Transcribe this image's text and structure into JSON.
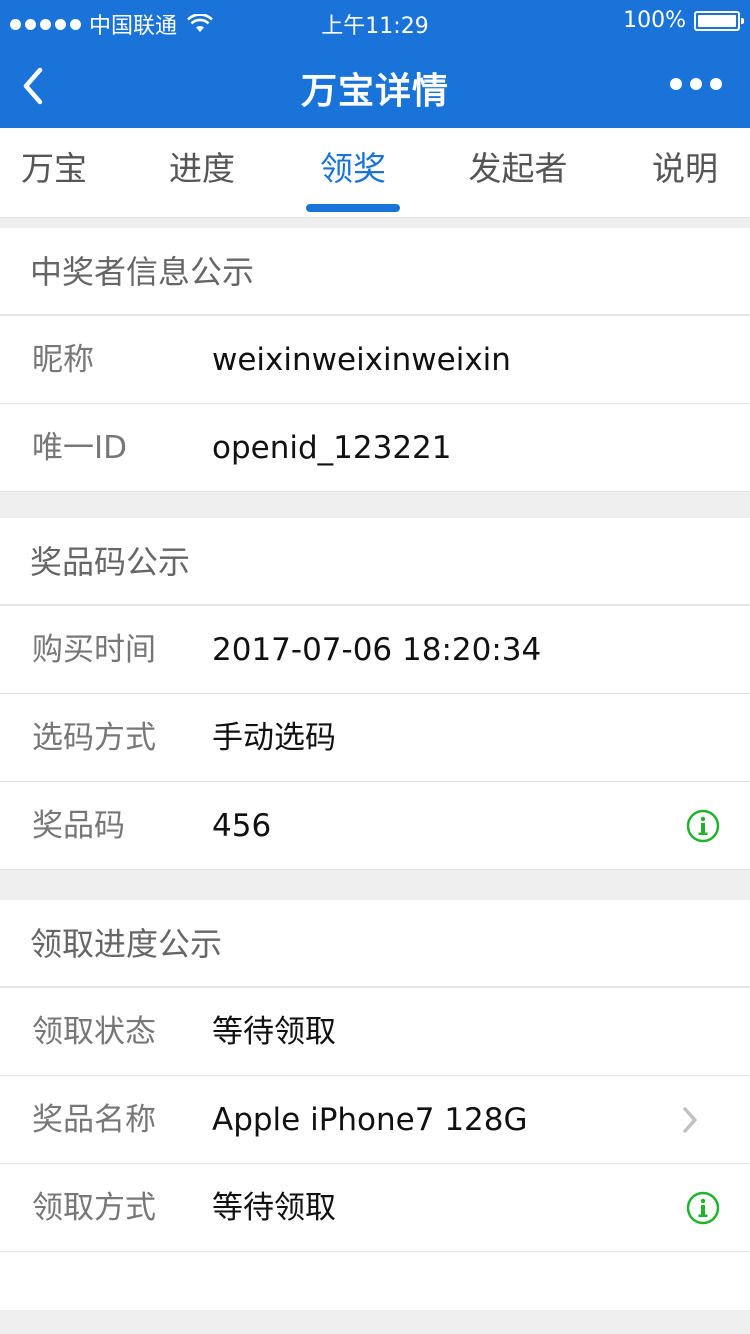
{
  "status_bar": {
    "carrier": "中国联通",
    "time": "上午11:29",
    "battery": "100%"
  },
  "nav": {
    "title": "万宝详情",
    "back_icon": "chevron-left-icon",
    "more_icon": "more-dots-icon"
  },
  "tabs": [
    {
      "label": "万宝"
    },
    {
      "label": "进度"
    },
    {
      "label": "领奖",
      "active": true
    },
    {
      "label": "发起者"
    },
    {
      "label": "说明"
    }
  ],
  "winner_info": {
    "header": "中奖者信息公示",
    "nickname_label": "昵称",
    "nickname_value": "weixinweixinweixin",
    "id_label": "唯一ID",
    "id_value": "openid_123221"
  },
  "prize_code": {
    "header": "奖品码公示",
    "time_label": "购买时间",
    "time_value": "2017-07-06 18:20:34",
    "method_label": "选码方式",
    "method_value": "手动选码",
    "code_label": "奖品码",
    "code_value": "456"
  },
  "claim_progress": {
    "header": "领取进度公示",
    "status_label": "领取状态",
    "status_value": "等待领取",
    "prize_name_label": "奖品名称",
    "prize_name_value": "Apple iPhone7 128G",
    "method_label": "领取方式",
    "method_value": "等待领取"
  },
  "colors": {
    "brand_blue": "#1a73d8",
    "info_green": "#1fb32e"
  }
}
